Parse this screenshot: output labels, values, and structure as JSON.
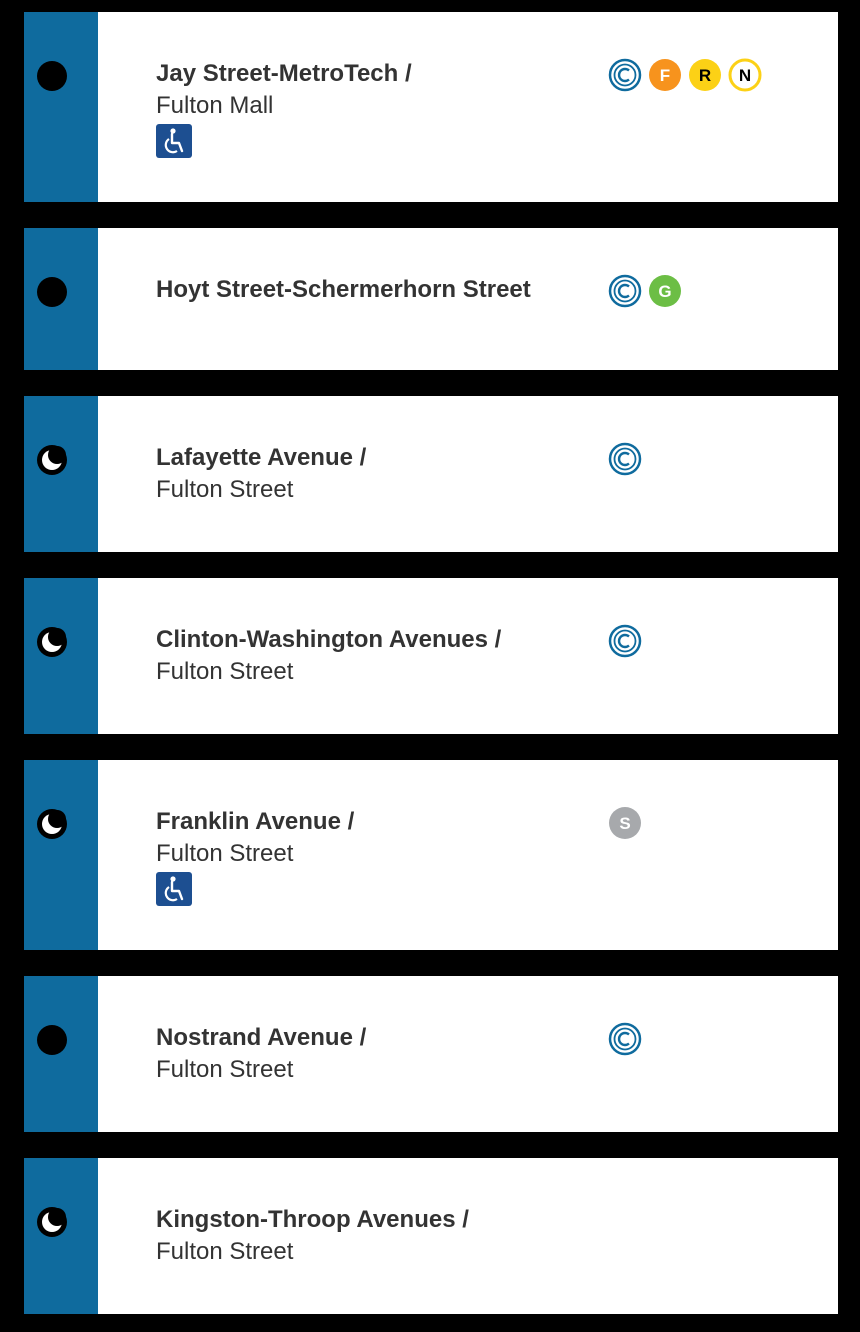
{
  "colors": {
    "background": "#000000",
    "stripe": "#0f6b9e",
    "route_C": "#0f6b9e",
    "route_F": "#f7931d",
    "route_R": "#fcd116",
    "route_N": "#fcd116",
    "route_G": "#6cbe45",
    "route_S": "#a7a9ac",
    "ada_badge": "#1d4f91"
  },
  "stations": [
    {
      "name": "Jay Street-MetroTech /",
      "sub": "Fulton Mall",
      "service": "full-time",
      "accessible": true,
      "routes": [
        "C",
        "F",
        "R",
        "N"
      ]
    },
    {
      "name": "Hoyt Street-Schermerhorn Street",
      "sub": "",
      "service": "full-time",
      "accessible": false,
      "routes": [
        "C",
        "G"
      ]
    },
    {
      "name": "Lafayette Avenue /",
      "sub": "Fulton Street",
      "service": "late-nights",
      "accessible": false,
      "routes": [
        "C"
      ]
    },
    {
      "name": "Clinton-Washington Avenues /",
      "sub": "Fulton Street",
      "service": "late-nights",
      "accessible": false,
      "routes": [
        "C"
      ]
    },
    {
      "name": "Franklin Avenue /",
      "sub": "Fulton Street",
      "service": "late-nights",
      "accessible": true,
      "routes": [
        "S"
      ]
    },
    {
      "name": "Nostrand Avenue /",
      "sub": "Fulton Street",
      "service": "full-time",
      "accessible": false,
      "routes": [
        "C"
      ]
    },
    {
      "name": "Kingston-Throop Avenues /",
      "sub": "Fulton Street",
      "service": "late-nights",
      "accessible": false,
      "routes": []
    }
  ]
}
